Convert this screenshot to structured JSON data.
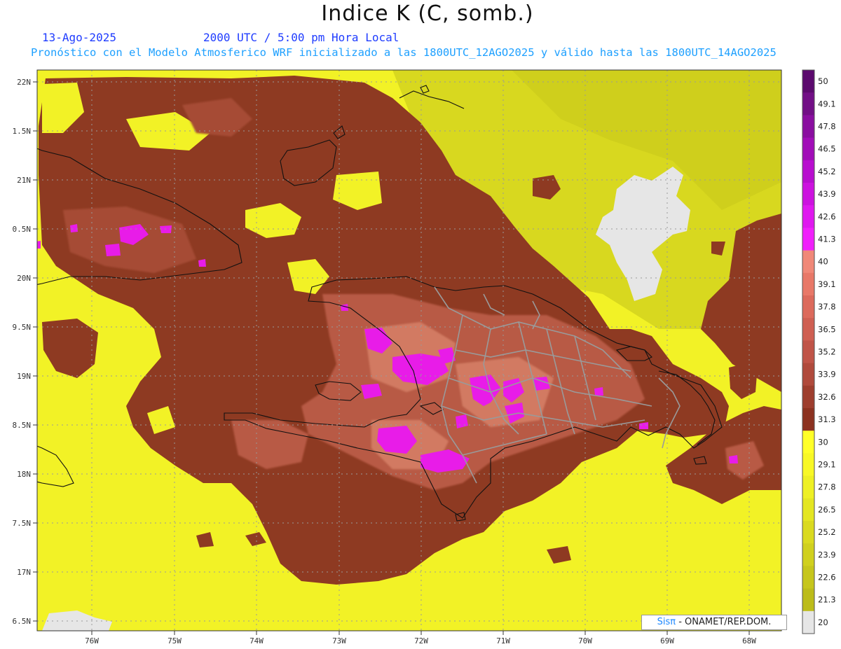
{
  "header": {
    "title": "Indice K (C, somb.)",
    "date": "13-Ago-2025",
    "time": "2000 UTC / 5:00 pm Hora Local",
    "model_line": "Pronóstico con el Modelo Atmosferico WRF inicializado a las 1800UTC_12AGO2025 y válido hasta las  1800UTC_14AGO2025"
  },
  "axes": {
    "lat_labels": [
      "22N",
      "1.5N",
      "21N",
      "0.5N",
      "20N",
      "9.5N",
      "19N",
      "8.5N",
      "18N",
      "7.5N",
      "17N",
      "6.5N"
    ],
    "lon_labels": [
      "76W",
      "75W",
      "74W",
      "73W",
      "72W",
      "71W",
      "70W",
      "69W",
      "68W"
    ]
  },
  "colorbar": {
    "labels": [
      "50",
      "49.1",
      "47.8",
      "46.5",
      "45.2",
      "43.9",
      "42.6",
      "41.3",
      "40",
      "39.1",
      "37.8",
      "36.5",
      "35.2",
      "33.9",
      "32.6",
      "31.3",
      "30",
      "29.1",
      "27.8",
      "26.5",
      "25.2",
      "23.9",
      "22.6",
      "21.3",
      "20"
    ],
    "colors": [
      "#5c0a6e",
      "#720f86",
      "#8a0ea0",
      "#a10db8",
      "#b80ecf",
      "#cc12df",
      "#df18ef",
      "#f020fb",
      "#f08878",
      "#e87868",
      "#dc6a5c",
      "#cf5f52",
      "#c05448",
      "#b04a3c",
      "#9e3e2e",
      "#8c3220",
      "#ffff28",
      "#f8f826",
      "#eef024",
      "#e4e622",
      "#dada20",
      "#d0d01e",
      "#c6c61c",
      "#bcbc1a",
      "#e6e6e6"
    ]
  },
  "map_colors": {
    "yellow": "#f2f226",
    "olive": "#d4d41e",
    "brown": "#8e3a22",
    "salmon": "#c96a54",
    "magenta": "#e81ce8",
    "gray": "#e6e6e6"
  },
  "credit": {
    "logo": "Sisπ",
    "text": " - ONAMET/REP.DOM."
  }
}
